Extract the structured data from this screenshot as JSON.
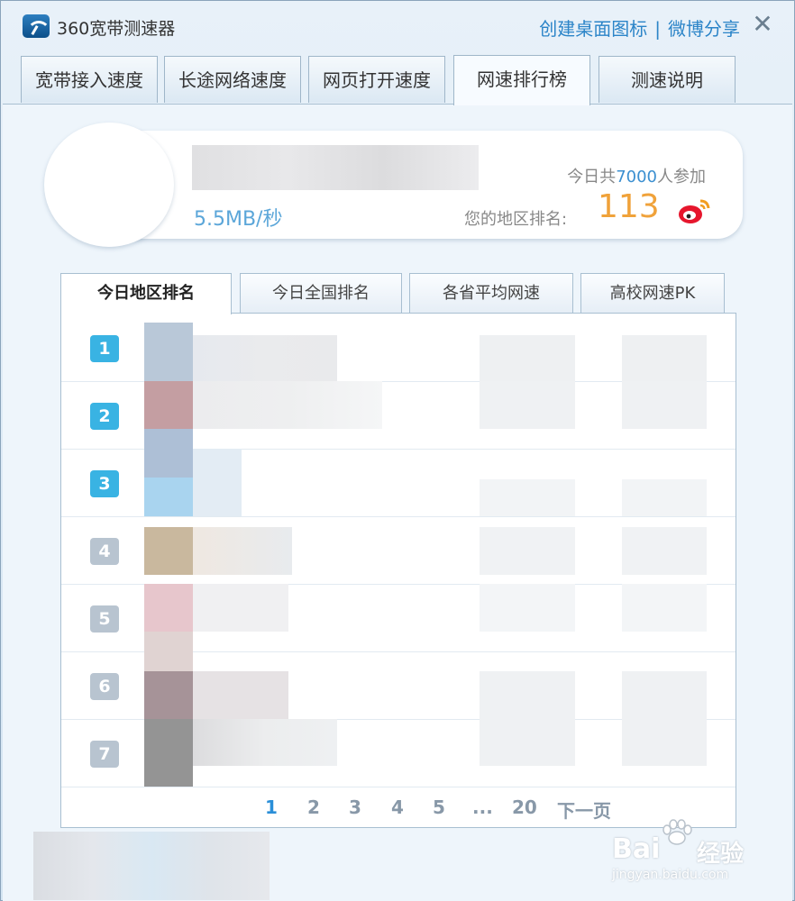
{
  "titlebar": {
    "app_name": "360宽带测速器",
    "link_desktop_icon": "创建桌面图标",
    "separator": "|",
    "link_weibo_share": "微博分享",
    "close_glyph": "✕"
  },
  "main_tabs": [
    {
      "label": "宽带接入速度"
    },
    {
      "label": "长途网络速度"
    },
    {
      "label": "网页打开速度"
    },
    {
      "label": "网速排行榜",
      "active": true
    },
    {
      "label": "测速说明"
    }
  ],
  "summary": {
    "speed": "5.5MB/秒",
    "participants_prefix": "今日共",
    "participants_count": "7000",
    "participants_suffix": "人参加",
    "rank_label": "您的地区排名:",
    "rank_value": "113"
  },
  "ranking_tabs": [
    {
      "label": "今日地区排名",
      "active": true
    },
    {
      "label": "今日全国排名"
    },
    {
      "label": "各省平均网速"
    },
    {
      "label": "高校网速PK"
    }
  ],
  "ranking_rows": [
    {
      "rank": "1",
      "tier": "top"
    },
    {
      "rank": "2",
      "tier": "top"
    },
    {
      "rank": "3",
      "tier": "top"
    },
    {
      "rank": "4",
      "tier": "rest"
    },
    {
      "rank": "5",
      "tier": "rest"
    },
    {
      "rank": "6",
      "tier": "rest"
    },
    {
      "rank": "7",
      "tier": "rest"
    }
  ],
  "pagination": {
    "pages": [
      "1",
      "2",
      "3",
      "4",
      "5",
      "...",
      "20"
    ],
    "current": "1",
    "next_label": "下一页"
  },
  "watermark": {
    "brand": "Bai",
    "brand_suffix": "经验",
    "url": "jingyan.baidu.com"
  },
  "colors": {
    "accent": "#2b84c8",
    "rank_orange": "#f0a23a",
    "badge_top": "#39b3e3",
    "badge_rest": "#b8c4d0"
  }
}
